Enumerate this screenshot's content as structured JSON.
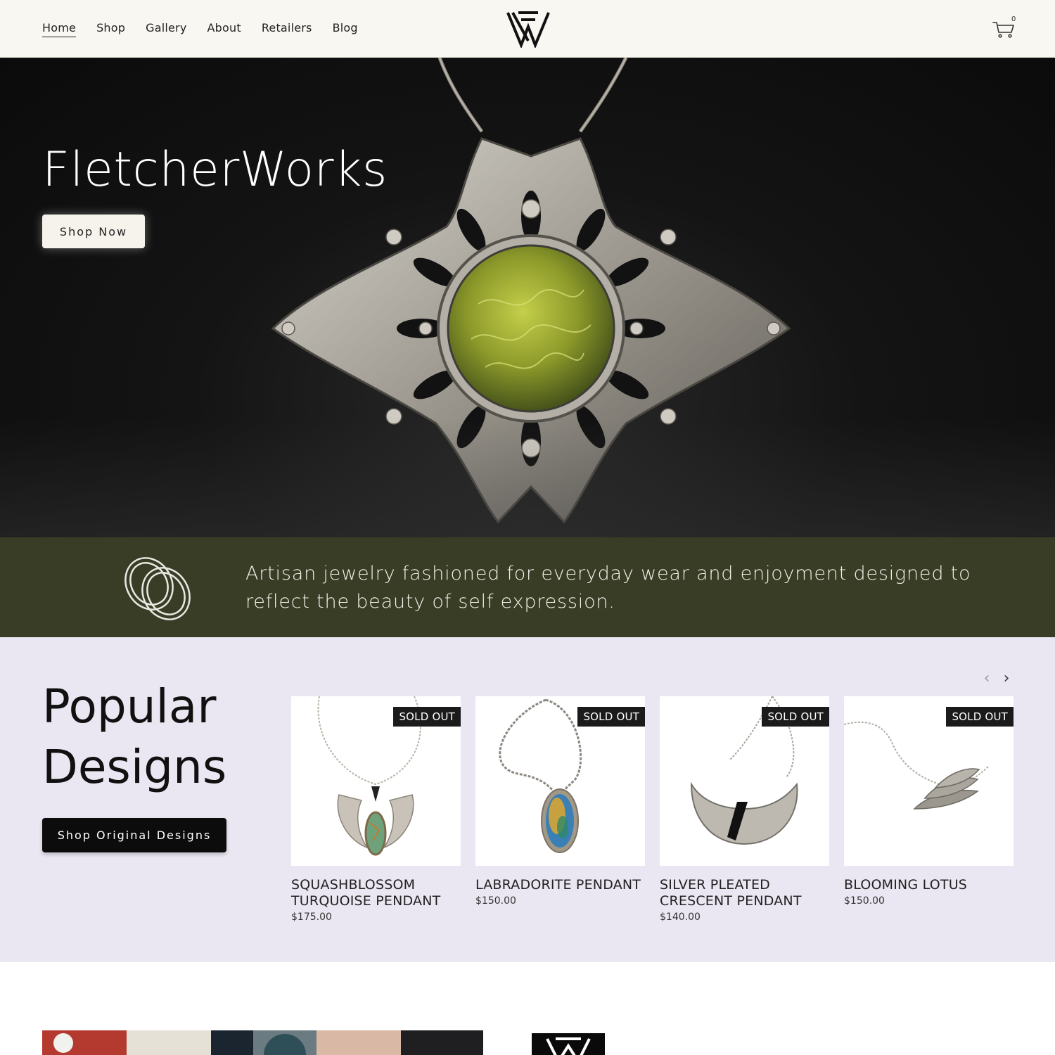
{
  "header": {
    "nav": [
      "Home",
      "Shop",
      "Gallery",
      "About",
      "Retailers",
      "Blog"
    ],
    "active": "Home",
    "cart_count": "0",
    "logo_icon": "fletcherworks-monogram-icon",
    "cart_icon": "cart-icon"
  },
  "hero": {
    "title": "FletcherWorks",
    "cta": "Shop Now",
    "image": "silver-moss-pendant"
  },
  "tagline": {
    "icon": "rings-icon",
    "text": "Artisan jewelry fashioned for everyday wear and enjoyment designed to reflect the beauty of self expression."
  },
  "popular": {
    "title": "Popular Designs",
    "cta": "Shop Original Designs",
    "prev_icon": "chevron-left-icon",
    "next_icon": "chevron-right-icon",
    "products": [
      {
        "name": "SQUASHBLOSSOM TURQUOISE PENDANT",
        "price": "$175.00",
        "badge": "SOLD OUT"
      },
      {
        "name": "LABRADORITE PENDANT",
        "price": "$150.00",
        "badge": "SOLD OUT"
      },
      {
        "name": "SILVER PLEATED CRESCENT PENDANT",
        "price": "$140.00",
        "badge": "SOLD OUT"
      },
      {
        "name": "BLOOMING LOTUS",
        "price": "$150.00",
        "badge": "SOLD OUT"
      }
    ]
  },
  "colors": {
    "header_bg": "#f9f7f2",
    "band_bg": "#3a3d25",
    "popular_bg": "#ebe7f2",
    "badge_bg": "#1b1b1b"
  }
}
